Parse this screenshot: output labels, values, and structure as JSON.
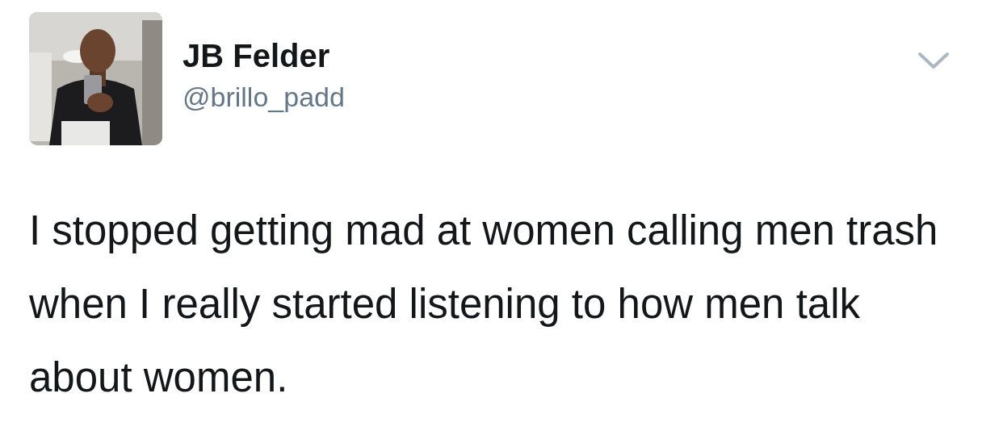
{
  "tweet": {
    "author": {
      "name": "JB Felder",
      "handle": "@brillo_padd"
    },
    "text": "I stopped getting mad at women calling men trash when I really started listening to how men talk about women."
  }
}
